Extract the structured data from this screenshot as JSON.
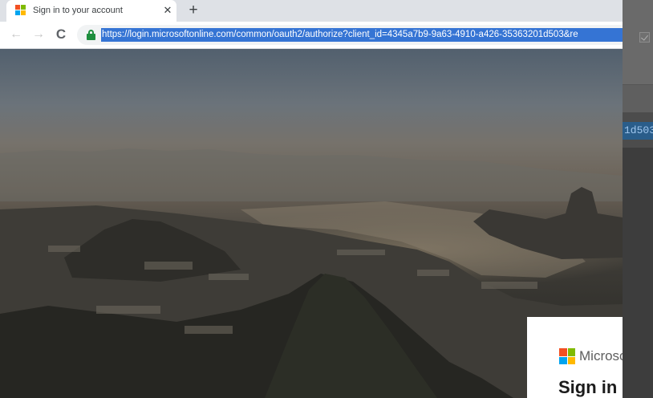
{
  "browser": {
    "tab": {
      "title": "Sign in to your account",
      "favicon": "microsoft-logo-icon",
      "close_glyph": "✕"
    },
    "new_tab_glyph": "+",
    "nav": {
      "back_glyph": "←",
      "forward_glyph": "→",
      "reload_glyph": "C"
    },
    "address_bar": {
      "secure_icon": "lock-icon",
      "url": "https://login.microsoftonline.com/common/oauth2/authorize?client_id=4345a7b9-9a63-4910-a426-35363201d503&re"
    }
  },
  "signin": {
    "brand": "Microsoft",
    "title": "Sign in"
  },
  "background_window": {
    "selected_text": "1d503"
  },
  "colors": {
    "url_selection": "#3574d4",
    "lock_green": "#1e8e3e",
    "ms_red": "#f25022",
    "ms_green": "#7fba00",
    "ms_blue": "#00a4ef",
    "ms_yellow": "#ffb900"
  }
}
